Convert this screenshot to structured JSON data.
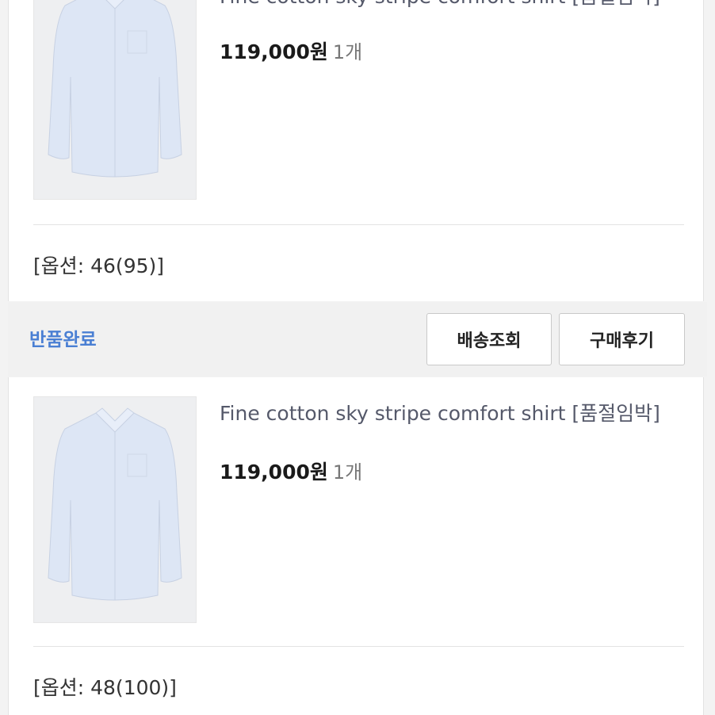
{
  "orders": [
    {
      "product_title": "Fine cotton sky stripe comfort shirt [품절임박]",
      "price": "119,000원",
      "quantity": "1개",
      "option": "[옵션: 46(95)]"
    },
    {
      "product_title": "Fine cotton sky stripe comfort shirt [품절임박]",
      "price": "119,000원",
      "quantity": "1개",
      "option": "[옵션: 48(100)]"
    }
  ],
  "action_bar": {
    "status": "반품완료",
    "shipping_button": "배송조회",
    "review_button": "구매후기"
  },
  "colors": {
    "status_blue": "#4a7fd3",
    "title_gray": "#55596a"
  },
  "icons": {
    "product_image": "shirt-image"
  }
}
